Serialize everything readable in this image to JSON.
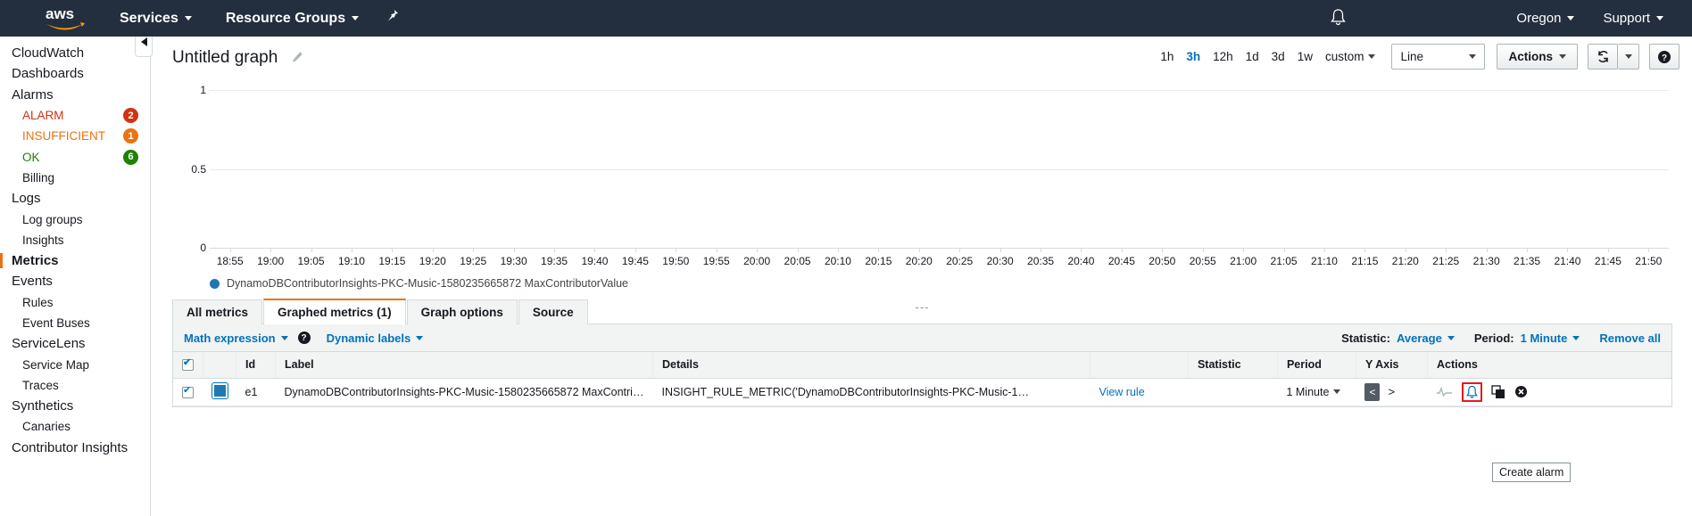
{
  "topnav": {
    "logo_alt": "aws",
    "services_label": "Services",
    "resource_groups_label": "Resource Groups",
    "pin_icon": "pin-icon",
    "bell_icon": "bell-icon",
    "region_label": "Oregon",
    "support_label": "Support"
  },
  "sidebar": {
    "items": [
      {
        "label": "CloudWatch",
        "level": "top",
        "active": false
      },
      {
        "label": "Dashboards",
        "level": "top",
        "active": false
      },
      {
        "label": "Alarms",
        "level": "top",
        "active": false
      },
      {
        "label": "ALARM",
        "level": "sub",
        "active": false,
        "color": "#d13212",
        "badge": "2",
        "badge_color": "#d13212"
      },
      {
        "label": "INSUFFICIENT",
        "level": "sub",
        "active": false,
        "color": "#ec7211",
        "badge": "1",
        "badge_color": "#ec7211"
      },
      {
        "label": "OK",
        "level": "sub",
        "active": false,
        "color": "#1d8102",
        "badge": "6",
        "badge_color": "#1d8102"
      },
      {
        "label": "Billing",
        "level": "sub",
        "active": false
      },
      {
        "label": "Logs",
        "level": "top",
        "active": false
      },
      {
        "label": "Log groups",
        "level": "sub",
        "active": false
      },
      {
        "label": "Insights",
        "level": "sub",
        "active": false
      },
      {
        "label": "Metrics",
        "level": "top",
        "active": true
      },
      {
        "label": "Events",
        "level": "top",
        "active": false
      },
      {
        "label": "Rules",
        "level": "sub",
        "active": false
      },
      {
        "label": "Event Buses",
        "level": "sub",
        "active": false
      },
      {
        "label": "ServiceLens",
        "level": "top",
        "active": false
      },
      {
        "label": "Service Map",
        "level": "sub",
        "active": false
      },
      {
        "label": "Traces",
        "level": "sub",
        "active": false
      },
      {
        "label": "Synthetics",
        "level": "top",
        "active": false
      },
      {
        "label": "Canaries",
        "level": "sub",
        "active": false
      },
      {
        "label": "Contributor Insights",
        "level": "top",
        "active": false
      }
    ],
    "collapse_icon": "chevron-left-icon"
  },
  "graph_header": {
    "title": "Untitled graph",
    "edit_icon": "pencil-icon",
    "time_ranges": [
      {
        "label": "1h",
        "selected": false
      },
      {
        "label": "3h",
        "selected": true
      },
      {
        "label": "12h",
        "selected": false
      },
      {
        "label": "1d",
        "selected": false
      },
      {
        "label": "3d",
        "selected": false
      },
      {
        "label": "1w",
        "selected": false
      }
    ],
    "custom_label": "custom",
    "graph_type": "Line",
    "actions_label": "Actions",
    "refresh_icon": "refresh-icon",
    "refresh_split_icon": "chevron-down-icon",
    "help_icon": "question-mark-icon"
  },
  "chart_data": {
    "type": "line",
    "title": "Untitled graph",
    "xlabel": "",
    "ylabel": "",
    "ylim": [
      0,
      1
    ],
    "yticks": [
      "0",
      "0.5",
      "1"
    ],
    "grid": true,
    "legend_position": "bottom-left",
    "xticks": [
      "18:55",
      "19:00",
      "19:05",
      "19:10",
      "19:15",
      "19:20",
      "19:25",
      "19:30",
      "19:35",
      "19:40",
      "19:45",
      "19:50",
      "19:55",
      "20:00",
      "20:05",
      "20:10",
      "20:15",
      "20:20",
      "20:25",
      "20:30",
      "20:35",
      "20:40",
      "20:45",
      "20:50",
      "20:55",
      "21:00",
      "21:05",
      "21:10",
      "21:15",
      "21:20",
      "21:25",
      "21:30",
      "21:35",
      "21:40",
      "21:45",
      "21:50"
    ],
    "series": [
      {
        "name": "DynamoDBContributorInsights-PKC-Music-1580235665872 MaxContributorValue",
        "color": "#1f77b4",
        "values": []
      }
    ],
    "no_data_marker": "---"
  },
  "tabs": [
    {
      "label": "All metrics",
      "active": false
    },
    {
      "label": "Graphed metrics (1)",
      "active": true
    },
    {
      "label": "Graph options",
      "active": false
    },
    {
      "label": "Source",
      "active": false
    }
  ],
  "panel_toolbar": {
    "math_expression_label": "Math expression",
    "help_icon": "question-mark-icon",
    "dynamic_labels_label": "Dynamic labels",
    "statistic_label": "Statistic:",
    "statistic_value": "Average",
    "period_label": "Period:",
    "period_value": "1 Minute",
    "remove_all_label": "Remove all"
  },
  "table": {
    "headers": [
      "",
      "",
      "Id",
      "Label",
      "Details",
      "",
      "Statistic",
      "Period",
      "Y Axis",
      "Actions"
    ],
    "header_checkbox_checked": true,
    "rows": [
      {
        "checked": true,
        "color": "#1f77b4",
        "id": "e1",
        "label": "DynamoDBContributorInsights-PKC-Music-1580235665872 MaxContri…",
        "details": "INSIGHT_RULE_METRIC('DynamoDBContributorInsights-PKC-Music-1…",
        "view_rule_label": "View rule",
        "statistic": "",
        "period": "1 Minute",
        "y_axis_left": "<",
        "y_axis_right": ">",
        "actions": [
          "sparkline-icon",
          "create-alarm-bell-icon",
          "duplicate-icon",
          "remove-icon"
        ]
      }
    ]
  },
  "tooltip": {
    "text": "Create alarm"
  }
}
